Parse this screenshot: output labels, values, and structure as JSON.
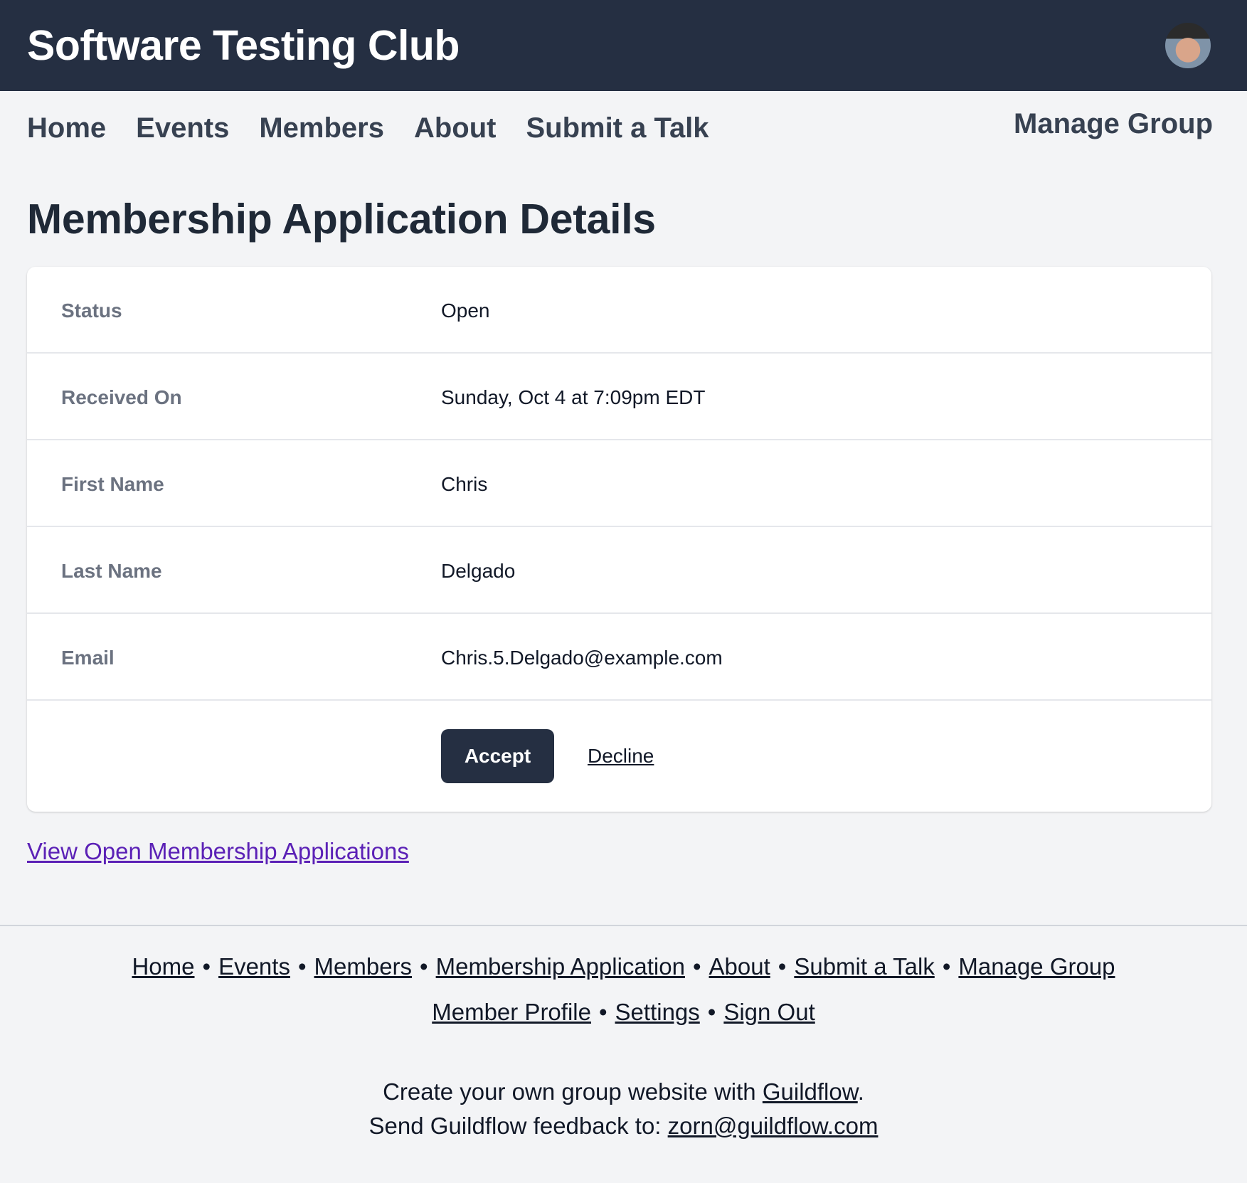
{
  "header": {
    "site_title": "Software Testing Club",
    "avatar_icon": "user-avatar"
  },
  "nav": {
    "items": [
      "Home",
      "Events",
      "Members",
      "About",
      "Submit a Talk"
    ],
    "manage_group": "Manage Group"
  },
  "page": {
    "title": "Membership Application Details"
  },
  "details": [
    {
      "label": "Status",
      "value": "Open"
    },
    {
      "label": "Received On",
      "value": "Sunday, Oct 4 at 7:09pm EDT"
    },
    {
      "label": "First Name",
      "value": "Chris"
    },
    {
      "label": "Last Name",
      "value": "Delgado"
    },
    {
      "label": "Email",
      "value": "Chris.5.Delgado@example.com"
    }
  ],
  "actions": {
    "accept_label": "Accept",
    "decline_label": "Decline"
  },
  "view_open_link": "View Open Membership Applications",
  "footer": {
    "links_row1": [
      "Home",
      "Events",
      "Members",
      "Membership Application",
      "About",
      "Submit a Talk",
      "Manage Group"
    ],
    "links_row2": [
      "Member Profile",
      "Settings",
      "Sign Out"
    ],
    "separator": "•",
    "promo_prefix": "Create your own group website with ",
    "promo_link": "Guildflow",
    "promo_suffix": ".",
    "feedback_prefix": "Send Guildflow feedback to: ",
    "feedback_email": "zorn@guildflow.com"
  },
  "colors": {
    "header_bg": "#252f42",
    "page_bg": "#f3f4f6",
    "link_purple": "#5b21b6"
  }
}
